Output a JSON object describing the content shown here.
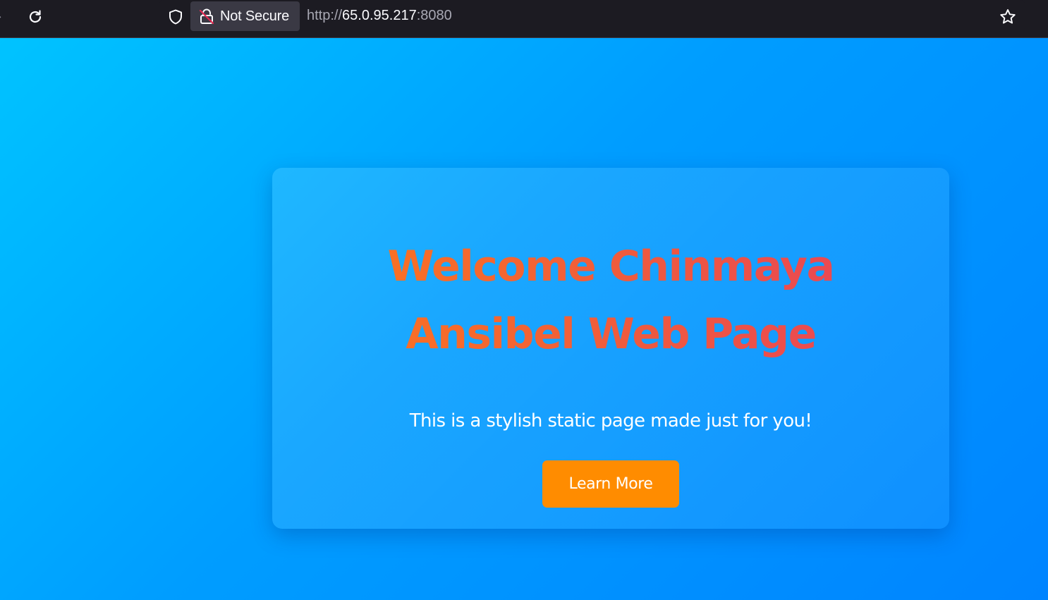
{
  "browser": {
    "security_label": "Not Secure",
    "url_scheme": "http://",
    "url_host": "65.0.95.217",
    "url_port": ":8080",
    "icons": {
      "reload": "reload-icon",
      "shield": "shield-icon",
      "insecure_lock": "insecure-lock-icon",
      "bookmark": "star-icon"
    }
  },
  "page": {
    "headline_line1": "Welcome Chinmaya",
    "headline_line2": "Ansibel Web Page",
    "subtitle": "This is a stylish static page made just for you!",
    "button_label": "Learn More",
    "colors": {
      "background_start": "#00c3ff",
      "background_end": "#0084ff",
      "headline_start": "#ff7a18",
      "headline_end": "#e8405c",
      "button": "#ff8c00"
    }
  }
}
